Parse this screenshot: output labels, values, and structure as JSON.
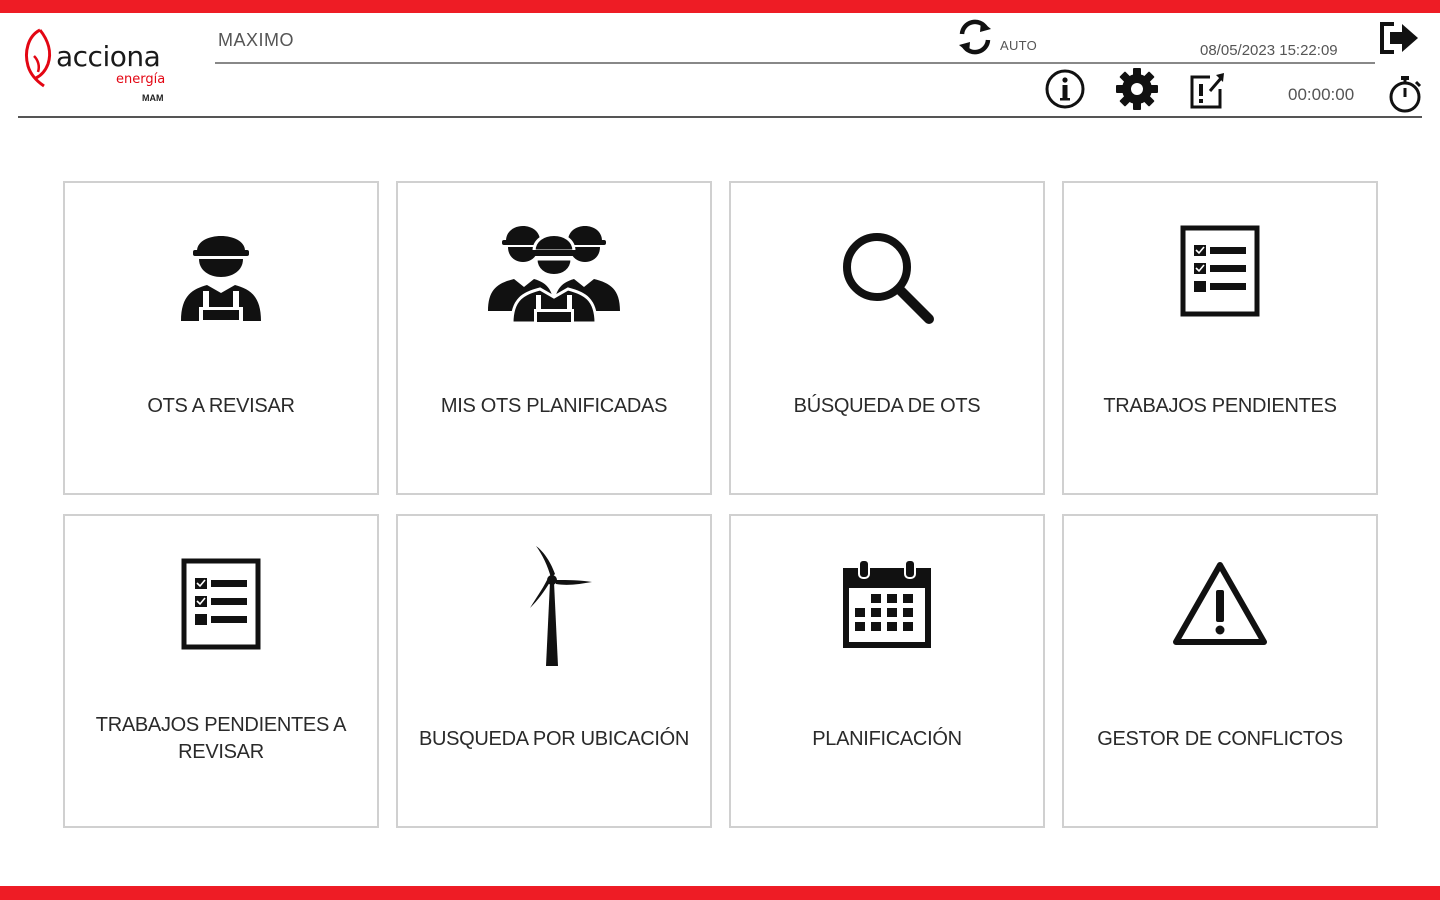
{
  "brand": {
    "name": "acciona",
    "sub": "energía",
    "tiny": "MAM",
    "accent_color": "#ee1c25"
  },
  "header": {
    "user": "MAXIMO",
    "sync_mode": "AUTO",
    "datetime": "08/05/2023 15:22:09",
    "timer": "00:00:00",
    "icons": [
      "sync-icon",
      "logout-icon",
      "info-icon",
      "gear-icon",
      "export-icon",
      "stopwatch-icon"
    ]
  },
  "tiles": [
    {
      "label": "OTS A REVISAR",
      "icon": "worker-icon"
    },
    {
      "label": "MIS OTS PLANIFICADAS",
      "icon": "workers-group-icon"
    },
    {
      "label": "BÚSQUEDA DE OTS",
      "icon": "search-icon"
    },
    {
      "label": "TRABAJOS PENDIENTES",
      "icon": "checklist-icon"
    },
    {
      "label_line1": "TRABAJOS PENDIENTES A",
      "label_line2": "REVISAR",
      "icon": "checklist-icon"
    },
    {
      "label": "BUSQUEDA POR UBICACIÓN",
      "icon": "wind-turbine-icon"
    },
    {
      "label": "PLANIFICACIÓN",
      "icon": "calendar-icon"
    },
    {
      "label": "GESTOR DE CONFLICTOS",
      "icon": "warning-icon"
    }
  ]
}
